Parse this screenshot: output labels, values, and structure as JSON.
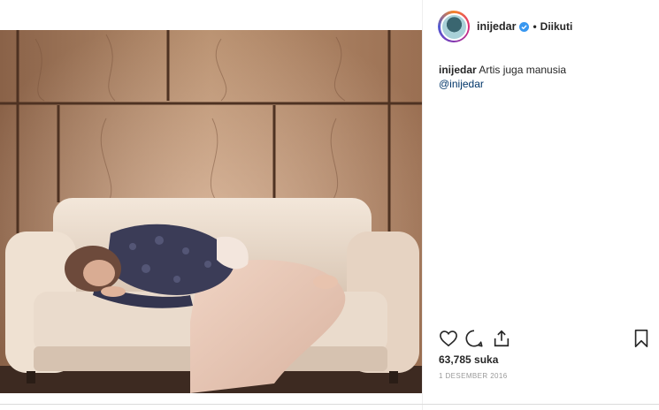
{
  "post": {
    "author": {
      "username": "inijedar",
      "verified_icon": "verified-badge-icon",
      "separator": "•",
      "follow_status": "Diikuti"
    },
    "caption": {
      "username": "inijedar",
      "text": "Artis juga manusia",
      "mention": "@inijedar"
    },
    "actions": {
      "like_icon": "heart-icon",
      "comment_icon": "comment-icon",
      "share_icon": "share-icon",
      "save_icon": "bookmark-icon"
    },
    "likes": "63,785 suka",
    "date": "1 DESEMBER 2016"
  },
  "colors": {
    "verified": "#3897f0",
    "mention": "#003569",
    "muted": "#999999"
  }
}
